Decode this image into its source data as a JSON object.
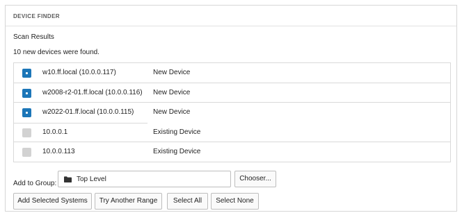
{
  "panel": {
    "title": "DEVICE FINDER"
  },
  "scan": {
    "title": "Scan Results",
    "summary": "10 new devices were found."
  },
  "devices": [
    {
      "host": "w10.ff.local (10.0.0.117)",
      "status": "New Device",
      "checked": true
    },
    {
      "host": "w2008-r2-01.ff.local (10.0.0.116)",
      "status": "New Device",
      "checked": true
    },
    {
      "host": "w2022-01.ff.local (10.0.0.115)",
      "status": "New Device",
      "checked": true
    },
    {
      "host": "10.0.0.1",
      "status": "Existing Device",
      "checked": false
    },
    {
      "host": "10.0.0.113",
      "status": "Existing Device",
      "checked": false
    }
  ],
  "group": {
    "label": "Add to Group:",
    "value": "Top Level",
    "chooser_label": "Chooser..."
  },
  "actions": {
    "add_selected": "Add Selected Systems",
    "try_range": "Try Another Range",
    "select_all": "Select All",
    "select_none": "Select None"
  },
  "colors": {
    "checked": "#1c76b8",
    "unchecked": "#d2d2d2",
    "border": "#d9d9d9"
  },
  "icons": {
    "folder": "folder-icon"
  }
}
